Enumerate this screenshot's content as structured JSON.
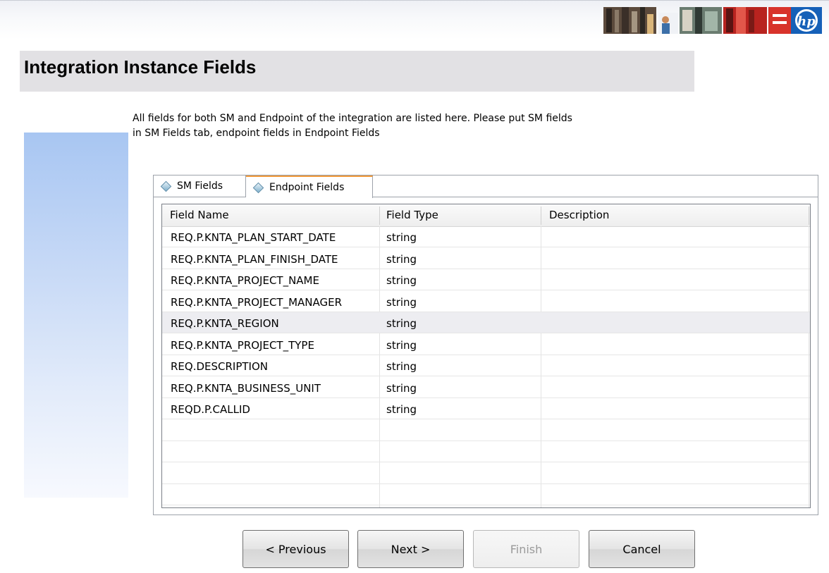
{
  "header": {
    "banner_icon": "hp-photo-banner-logo",
    "title": "Integration Instance Fields"
  },
  "instructions": {
    "line1": "All fields for both SM and Endpoint of the integration are listed here.  Please put SM fields",
    "line2": "in SM Fields tab, endpoint fields in Endpoint Fields"
  },
  "tabs": [
    {
      "label": "SM Fields",
      "selected": false,
      "icon": "diamond-icon"
    },
    {
      "label": "Endpoint Fields",
      "selected": true,
      "icon": "diamond-icon"
    }
  ],
  "table": {
    "columns": [
      "Field Name",
      "Field Type",
      "Description"
    ],
    "rows": [
      {
        "name": "REQ.P.KNTA_PLAN_START_DATE",
        "type": "string",
        "desc": ""
      },
      {
        "name": "REQ.P.KNTA_PLAN_FINISH_DATE",
        "type": "string",
        "desc": ""
      },
      {
        "name": "REQ.P.KNTA_PROJECT_NAME",
        "type": "string",
        "desc": ""
      },
      {
        "name": "REQ.P.KNTA_PROJECT_MANAGER",
        "type": "string",
        "desc": ""
      },
      {
        "name": "REQ.P.KNTA_REGION",
        "type": "string",
        "desc": ""
      },
      {
        "name": "REQ.P.KNTA_PROJECT_TYPE",
        "type": "string",
        "desc": ""
      },
      {
        "name": "REQ.DESCRIPTION",
        "type": "string",
        "desc": ""
      },
      {
        "name": "REQ.P.KNTA_BUSINESS_UNIT",
        "type": "string",
        "desc": ""
      },
      {
        "name": "REQD.P.CALLID",
        "type": "string",
        "desc": ""
      }
    ],
    "hovered_row": 4
  },
  "buttons": {
    "previous": "< Previous",
    "next": "Next >",
    "finish": "Finish",
    "cancel": "Cancel"
  },
  "colors": {
    "title_bar": "#e2e1e4",
    "tab_active_accent": "#f29a3a",
    "hp_blue": "#1560b8"
  }
}
